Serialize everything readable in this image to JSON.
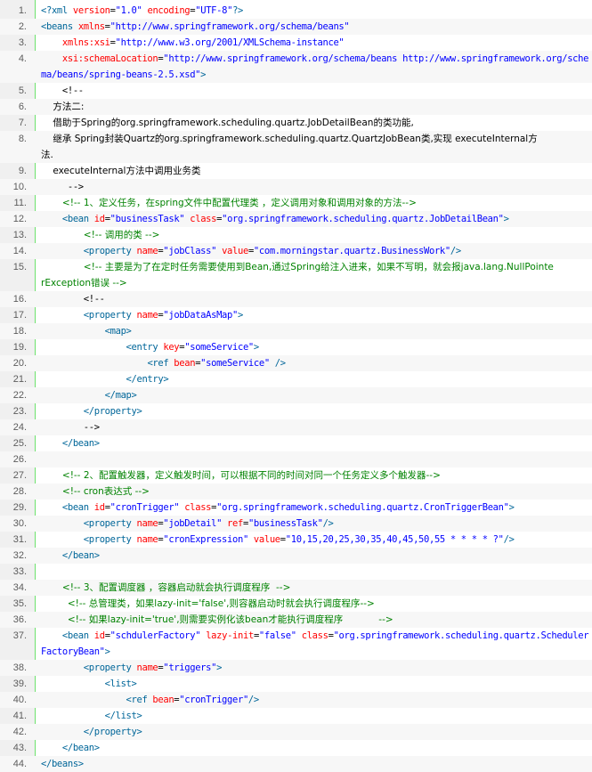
{
  "code": {
    "language": "xml",
    "lines": [
      {
        "n": "1.",
        "parts": [
          [
            "tag",
            "<?xml "
          ],
          [
            "attr",
            "version"
          ],
          [
            "plain",
            "="
          ],
          [
            "str",
            "\"1.0\""
          ],
          [
            "plain",
            " "
          ],
          [
            "attr",
            "encoding"
          ],
          [
            "plain",
            "="
          ],
          [
            "str",
            "\"UTF-8\""
          ],
          [
            "tag",
            "?>"
          ]
        ]
      },
      {
        "n": "2.",
        "parts": [
          [
            "tag",
            "<beans "
          ],
          [
            "attr",
            "xmlns"
          ],
          [
            "plain",
            "="
          ],
          [
            "str",
            "\"http://www.springframework.org/schema/beans\""
          ]
        ]
      },
      {
        "n": "3.",
        "parts": [
          [
            "plain",
            "    "
          ],
          [
            "attr",
            "xmlns:xsi"
          ],
          [
            "plain",
            "="
          ],
          [
            "str",
            "\"http://www.w3.org/2001/XMLSchema-instance\""
          ]
        ]
      },
      {
        "n": "4.",
        "parts": [
          [
            "plain",
            "    "
          ],
          [
            "attr",
            "xsi:schemaLocation"
          ],
          [
            "plain",
            "="
          ],
          [
            "str",
            "\"http://www.springframework.org/schema/beans http://www.springframework.org/sche"
          ]
        ]
      },
      {
        "n": "",
        "parts": [
          [
            "str",
            "ma/beans/spring-beans-2.5.xsd\""
          ],
          [
            "tag",
            ">"
          ]
        ]
      },
      {
        "n": "5.",
        "parts": [
          [
            "plain",
            "    <!--"
          ]
        ]
      },
      {
        "n": "6.",
        "parts": [
          [
            "plain",
            "    方法二:"
          ]
        ]
      },
      {
        "n": "7.",
        "parts": [
          [
            "plain",
            "    借助于Spring的org.springframework.scheduling.quartz.JobDetailBean的类功能,"
          ]
        ]
      },
      {
        "n": "8.",
        "parts": [
          [
            "plain",
            "    继承 Spring封装Quartz的org.springframework.scheduling.quartz.QuartzJobBean类,实现 executeInternal方"
          ]
        ]
      },
      {
        "n": "",
        "parts": [
          [
            "plain",
            "法."
          ]
        ]
      },
      {
        "n": "9.",
        "parts": [
          [
            "plain",
            "    executeInternal方法中调用业务类"
          ]
        ]
      },
      {
        "n": "10.",
        "parts": [
          [
            "plain",
            "     -->"
          ]
        ]
      },
      {
        "n": "11.",
        "parts": [
          [
            "plain",
            "    "
          ],
          [
            "cmt",
            "<!-- 1、定义任务，在spring文件中配置代理类 ，定义调用对象和调用对象的方法-->"
          ]
        ]
      },
      {
        "n": "12.",
        "parts": [
          [
            "plain",
            "    "
          ],
          [
            "tag",
            "<bean "
          ],
          [
            "attr",
            "id"
          ],
          [
            "plain",
            "="
          ],
          [
            "str",
            "\"businessTask\""
          ],
          [
            "plain",
            " "
          ],
          [
            "attr",
            "class"
          ],
          [
            "plain",
            "="
          ],
          [
            "str",
            "\"org.springframework.scheduling.quartz.JobDetailBean\""
          ],
          [
            "tag",
            ">"
          ]
        ]
      },
      {
        "n": "13.",
        "parts": [
          [
            "plain",
            "        "
          ],
          [
            "cmt",
            "<!-- 调用的类 -->"
          ]
        ]
      },
      {
        "n": "14.",
        "parts": [
          [
            "plain",
            "        "
          ],
          [
            "tag",
            "<property "
          ],
          [
            "attr",
            "name"
          ],
          [
            "plain",
            "="
          ],
          [
            "str",
            "\"jobClass\""
          ],
          [
            "plain",
            " "
          ],
          [
            "attr",
            "value"
          ],
          [
            "plain",
            "="
          ],
          [
            "str",
            "\"com.morningstar.quartz.BusinessWork\""
          ],
          [
            "tag",
            "/>"
          ]
        ]
      },
      {
        "n": "15.",
        "parts": [
          [
            "plain",
            "        "
          ],
          [
            "cmt",
            "<!-- 主要是为了在定时任务需要使用到Bean,通过Spring给注入进来，如果不写明，就会报java.lang.NullPointe"
          ]
        ]
      },
      {
        "n": "",
        "parts": [
          [
            "cmt",
            "rException错误 -->"
          ]
        ]
      },
      {
        "n": "16.",
        "parts": [
          [
            "plain",
            "        <!--"
          ]
        ]
      },
      {
        "n": "17.",
        "parts": [
          [
            "plain",
            "        "
          ],
          [
            "tag",
            "<property "
          ],
          [
            "attr",
            "name"
          ],
          [
            "plain",
            "="
          ],
          [
            "str",
            "\"jobDataAsMap\""
          ],
          [
            "tag",
            ">"
          ]
        ]
      },
      {
        "n": "18.",
        "parts": [
          [
            "plain",
            "            "
          ],
          [
            "tag",
            "<map>"
          ]
        ]
      },
      {
        "n": "19.",
        "parts": [
          [
            "plain",
            "                "
          ],
          [
            "tag",
            "<entry "
          ],
          [
            "attr",
            "key"
          ],
          [
            "plain",
            "="
          ],
          [
            "str",
            "\"someService\""
          ],
          [
            "tag",
            ">"
          ]
        ]
      },
      {
        "n": "20.",
        "parts": [
          [
            "plain",
            "                    "
          ],
          [
            "tag",
            "<ref "
          ],
          [
            "attr",
            "bean"
          ],
          [
            "plain",
            "="
          ],
          [
            "str",
            "\"someService\""
          ],
          [
            "plain",
            " "
          ],
          [
            "tag",
            "/>"
          ]
        ]
      },
      {
        "n": "21.",
        "parts": [
          [
            "plain",
            "                "
          ],
          [
            "tag",
            "</entry>"
          ]
        ]
      },
      {
        "n": "22.",
        "parts": [
          [
            "plain",
            "            "
          ],
          [
            "tag",
            "</map>"
          ]
        ]
      },
      {
        "n": "23.",
        "parts": [
          [
            "plain",
            "        "
          ],
          [
            "tag",
            "</property>"
          ]
        ]
      },
      {
        "n": "24.",
        "parts": [
          [
            "plain",
            "        -->"
          ]
        ]
      },
      {
        "n": "25.",
        "parts": [
          [
            "plain",
            "    "
          ],
          [
            "tag",
            "</bean>"
          ]
        ]
      },
      {
        "n": "26.",
        "parts": [
          [
            "plain",
            ""
          ]
        ]
      },
      {
        "n": "27.",
        "parts": [
          [
            "plain",
            "    "
          ],
          [
            "cmt",
            "<!-- 2、配置触发器，定义触发时间，可以根据不同的时间对同一个任务定义多个触发器-->"
          ]
        ]
      },
      {
        "n": "28.",
        "parts": [
          [
            "plain",
            "    "
          ],
          [
            "cmt",
            "<!-- cron表达式 -->"
          ]
        ]
      },
      {
        "n": "29.",
        "parts": [
          [
            "plain",
            "    "
          ],
          [
            "tag",
            "<bean "
          ],
          [
            "attr",
            "id"
          ],
          [
            "plain",
            "="
          ],
          [
            "str",
            "\"cronTrigger\""
          ],
          [
            "plain",
            " "
          ],
          [
            "attr",
            "class"
          ],
          [
            "plain",
            "="
          ],
          [
            "str",
            "\"org.springframework.scheduling.quartz.CronTriggerBean\""
          ],
          [
            "tag",
            ">"
          ]
        ]
      },
      {
        "n": "30.",
        "parts": [
          [
            "plain",
            "        "
          ],
          [
            "tag",
            "<property "
          ],
          [
            "attr",
            "name"
          ],
          [
            "plain",
            "="
          ],
          [
            "str",
            "\"jobDetail\""
          ],
          [
            "plain",
            " "
          ],
          [
            "attr",
            "ref"
          ],
          [
            "plain",
            "="
          ],
          [
            "str",
            "\"businessTask\""
          ],
          [
            "tag",
            "/>"
          ]
        ]
      },
      {
        "n": "31.",
        "parts": [
          [
            "plain",
            "        "
          ],
          [
            "tag",
            "<property "
          ],
          [
            "attr",
            "name"
          ],
          [
            "plain",
            "="
          ],
          [
            "str",
            "\"cronExpression\""
          ],
          [
            "plain",
            " "
          ],
          [
            "attr",
            "value"
          ],
          [
            "plain",
            "="
          ],
          [
            "str",
            "\"10,15,20,25,30,35,40,45,50,55 * * * * ?\""
          ],
          [
            "tag",
            "/>"
          ]
        ]
      },
      {
        "n": "32.",
        "parts": [
          [
            "plain",
            "    "
          ],
          [
            "tag",
            "</bean>"
          ]
        ]
      },
      {
        "n": "33.",
        "parts": [
          [
            "plain",
            ""
          ]
        ]
      },
      {
        "n": "34.",
        "parts": [
          [
            "plain",
            "    "
          ],
          [
            "cmt",
            "<!-- 3、配置调度器 ，容器启动就会执行调度程序  -->"
          ]
        ]
      },
      {
        "n": "35.",
        "parts": [
          [
            "plain",
            "     "
          ],
          [
            "cmt",
            "<!-- 总管理类，如果lazy-init='false',则容器启动时就会执行调度程序-->"
          ]
        ]
      },
      {
        "n": "36.",
        "parts": [
          [
            "plain",
            "     "
          ],
          [
            "cmt",
            "<!-- 如果lazy-init='true',则需要实例化该bean才能执行调度程序            -->"
          ]
        ]
      },
      {
        "n": "37.",
        "parts": [
          [
            "plain",
            "    "
          ],
          [
            "tag",
            "<bean "
          ],
          [
            "attr",
            "id"
          ],
          [
            "plain",
            "="
          ],
          [
            "str",
            "\"schdulerFactory\""
          ],
          [
            "plain",
            " "
          ],
          [
            "attr",
            "lazy-init"
          ],
          [
            "plain",
            "="
          ],
          [
            "str",
            "\"false\""
          ],
          [
            "plain",
            " "
          ],
          [
            "attr",
            "class"
          ],
          [
            "plain",
            "="
          ],
          [
            "str",
            "\"org.springframework.scheduling.quartz.Scheduler"
          ]
        ]
      },
      {
        "n": "",
        "parts": [
          [
            "str",
            "FactoryBean\""
          ],
          [
            "tag",
            ">"
          ]
        ]
      },
      {
        "n": "38.",
        "parts": [
          [
            "plain",
            "        "
          ],
          [
            "tag",
            "<property "
          ],
          [
            "attr",
            "name"
          ],
          [
            "plain",
            "="
          ],
          [
            "str",
            "\"triggers\""
          ],
          [
            "tag",
            ">"
          ]
        ]
      },
      {
        "n": "39.",
        "parts": [
          [
            "plain",
            "            "
          ],
          [
            "tag",
            "<list>"
          ]
        ]
      },
      {
        "n": "40.",
        "parts": [
          [
            "plain",
            "                "
          ],
          [
            "tag",
            "<ref "
          ],
          [
            "attr",
            "bean"
          ],
          [
            "plain",
            "="
          ],
          [
            "str",
            "\"cronTrigger\""
          ],
          [
            "tag",
            "/>"
          ]
        ]
      },
      {
        "n": "41.",
        "parts": [
          [
            "plain",
            "            "
          ],
          [
            "tag",
            "</list>"
          ]
        ]
      },
      {
        "n": "42.",
        "parts": [
          [
            "plain",
            "        "
          ],
          [
            "tag",
            "</property>"
          ]
        ]
      },
      {
        "n": "43.",
        "parts": [
          [
            "plain",
            "    "
          ],
          [
            "tag",
            "</bean>"
          ]
        ]
      },
      {
        "n": "44.",
        "parts": [
          [
            "tag",
            "</beans>"
          ]
        ]
      }
    ]
  }
}
